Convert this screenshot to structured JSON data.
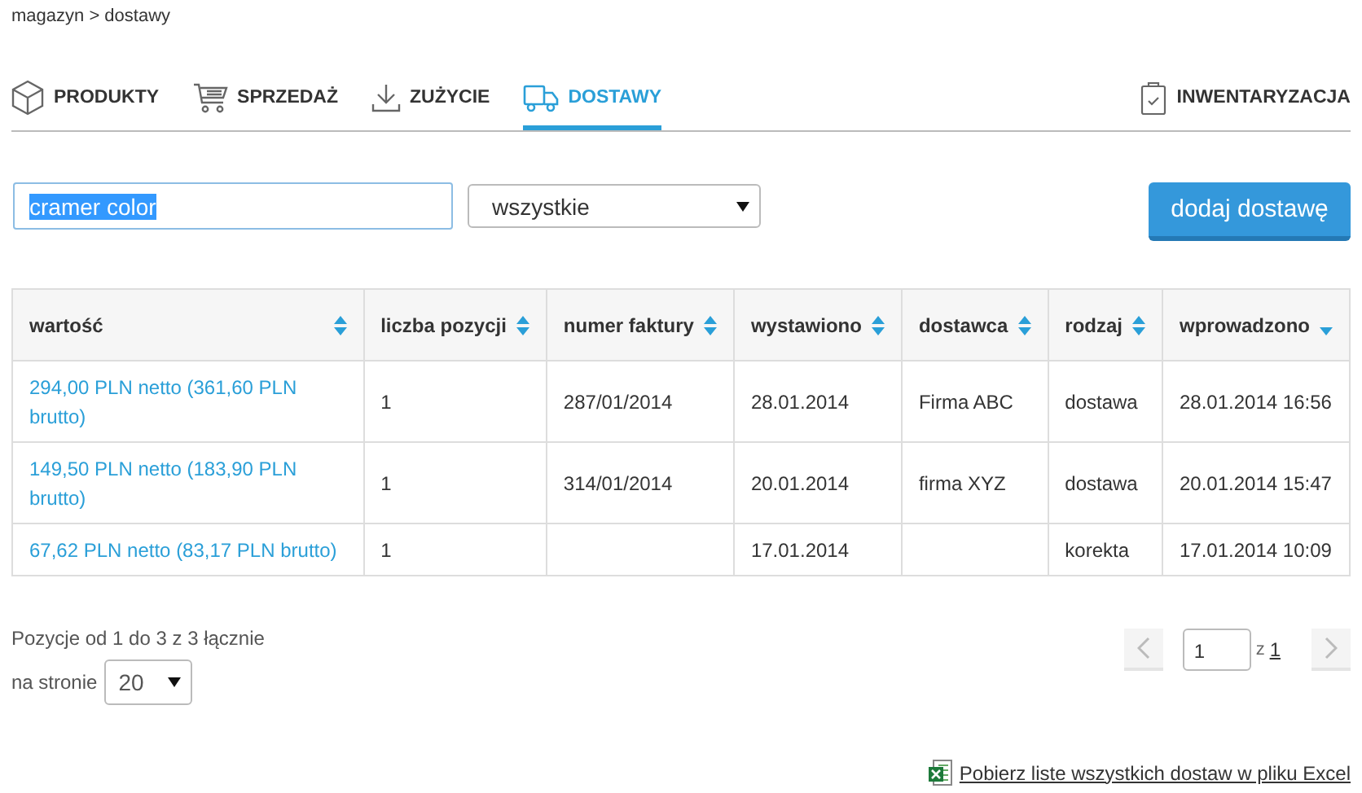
{
  "breadcrumb": "magazyn > dostawy",
  "tabs": [
    {
      "label": "PRODUKTY",
      "selected": false
    },
    {
      "label": "SPRZEDAŻ",
      "selected": false
    },
    {
      "label": "ZUŻYCIE",
      "selected": false
    },
    {
      "label": "DOSTAWY",
      "selected": true
    }
  ],
  "side_tab": {
    "label": "INWENTARYZACJA",
    "selected": false
  },
  "search": {
    "value": "cramer color",
    "text_selected": true
  },
  "filter": {
    "value": "wszystkie"
  },
  "add_button": "dodaj dostawę",
  "table": {
    "columns": [
      {
        "label": "wartość",
        "sorted": false
      },
      {
        "label": "liczba pozycji",
        "sorted": false
      },
      {
        "label": "numer faktury",
        "sorted": false
      },
      {
        "label": "wystawiono",
        "sorted": false
      },
      {
        "label": "dostawca",
        "sorted": false
      },
      {
        "label": "rodzaj",
        "sorted": false
      },
      {
        "label": "wprowadzono",
        "sorted": true
      }
    ],
    "rows": [
      [
        "294,00 PLN netto (361,60 PLN brutto)",
        "1",
        "287/01/2014",
        "28.01.2014",
        "Firma ABC",
        "dostawa",
        "28.01.2014 16:56"
      ],
      [
        "149,50 PLN netto (183,90 PLN brutto)",
        "1",
        "314/01/2014",
        "20.01.2014",
        "firma XYZ",
        "dostawa",
        "20.01.2014 15:47"
      ],
      [
        "67,62 PLN netto (83,17 PLN brutto)",
        "1",
        "",
        "17.01.2014",
        "",
        "korekta",
        "17.01.2014 10:09"
      ]
    ]
  },
  "summary": "Pozycje od 1 do 3 z 3 łącznie",
  "per_page": {
    "label": "na stronie",
    "value": "20"
  },
  "pagination": {
    "page": "1",
    "of_label": "z",
    "total": "1"
  },
  "excel_link": "Pobierz liste wszystkich dostaw w pliku Excel"
}
